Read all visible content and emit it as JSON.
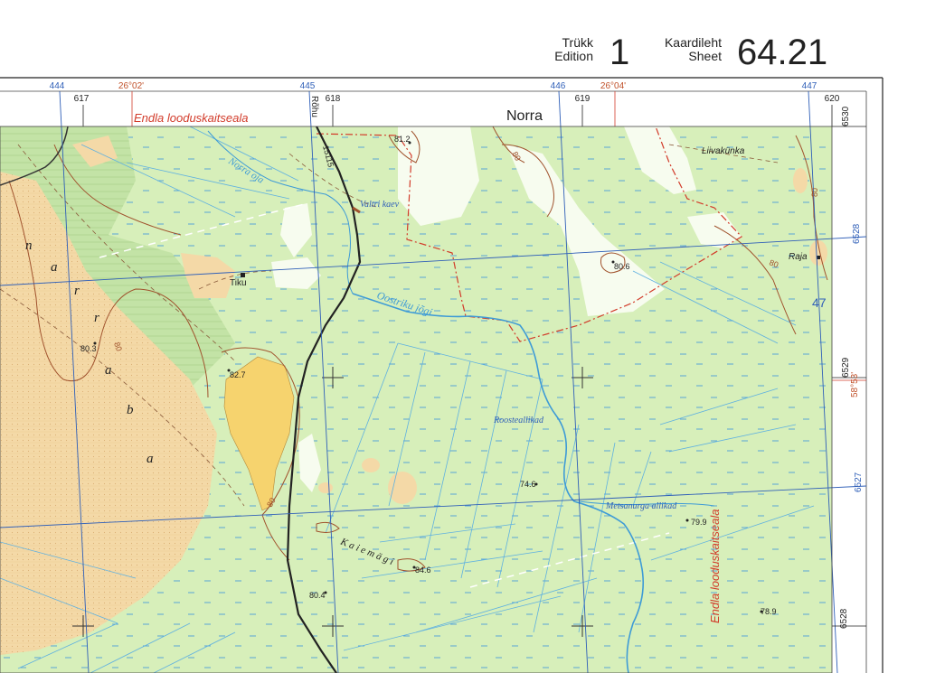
{
  "header": {
    "edition_label_et": "Trükk",
    "edition_label_en": "Edition",
    "edition_number": "1",
    "sheet_label_et": "Kaardileht",
    "sheet_label_en": "Sheet",
    "sheet_number": "64.21"
  },
  "frame": {
    "top_grid_labels": [
      "444",
      "445",
      "446",
      "447"
    ],
    "top_km_labels": [
      "617",
      "618",
      "619",
      "620"
    ],
    "top_lon_labels": [
      "26°02'",
      "26°04'"
    ],
    "right_grid_labels": [
      "6528",
      "6527"
    ],
    "right_km_labels": [
      "6530",
      "6529",
      "6528"
    ],
    "right_lat_label": "58°53'",
    "road_name_top": "Rõhu",
    "place_top": "Norra",
    "reserve_top": "Endla looduskaitseala",
    "reserve_right": "Endla looduskaitseala"
  },
  "map_labels": {
    "norra_oja": "Norra oja",
    "valtri_kaev": "Valtri kaev",
    "oostriku_jogi": "Oostriku jõgi",
    "tiku": "Tiku",
    "roosteallikad": "Roosteallikad",
    "metsanurga_allikad": "Metsanurga allikad",
    "kaiemagi": "K a i e m ä g i",
    "liivakunka": "Liivakünka",
    "raja": "Raja",
    "road_number": "15115",
    "sheet_ref": "47",
    "bog_letters": [
      "n",
      "a",
      "r",
      "r",
      "a",
      "b",
      "a"
    ]
  },
  "elevations": {
    "e812": "81.2",
    "e806": "80.6",
    "e803": "80.3",
    "e827": "82.7",
    "e746": "74.6",
    "e799": "79.9",
    "e846": "84.6",
    "e804": "80.4",
    "e789": "78.9"
  },
  "contour_labels": [
    "80",
    "80",
    "80",
    "80",
    "80"
  ],
  "colors": {
    "forest": "#d7efba",
    "bog": "#f4d9a7",
    "clearing": "#f7fcef",
    "grid": "#2f5fb8",
    "water": "#3e9bd6",
    "contour": "#a0522d",
    "reserve": "#d23b2a",
    "road": "#222222"
  }
}
